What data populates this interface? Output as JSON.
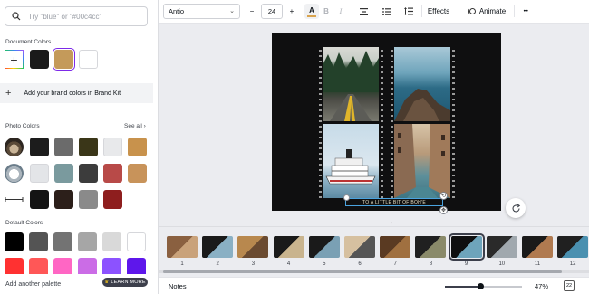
{
  "colors": {
    "accent": "#7d2ae8",
    "selection_blue": "#4aa3df",
    "text_color_bar": "#d9a44f"
  },
  "search": {
    "placeholder": "Try \"blue\" or \"#00c4cc\"",
    "icon": "search-icon"
  },
  "document_colors": {
    "title": "Document Colors",
    "swatches": [
      "#1a1a1a",
      "#c49a5a",
      "#ffffff"
    ],
    "selected_index": 1
  },
  "brand_kit": {
    "label": "Add your brand colors in Brand Kit"
  },
  "photo_colors": {
    "title": "Photo Colors",
    "see_all": "See all",
    "rows": [
      [
        "#1c1c1c",
        "#6b6b6b",
        "#3a3618",
        "#e8e9eb",
        "#c8924c"
      ],
      [
        "#e3e5e8",
        "#7a9a9e",
        "#3c3c3c",
        "#b84a48",
        "#c8935a"
      ],
      [
        "#141414",
        "#2c1f1a",
        "#8a8a8a",
        "#8e1e1e"
      ]
    ]
  },
  "default_colors": {
    "title": "Default Colors",
    "rows": [
      [
        "#000000",
        "#545454",
        "#737373",
        "#a6a6a6",
        "#d9d9d9",
        "#ffffff"
      ],
      [
        "#ff3131",
        "#ff5757",
        "#ff66c4",
        "#cb6ce6",
        "#8c52ff",
        "#5e17eb"
      ]
    ]
  },
  "panel_footer": {
    "add_palette": "Add another palette",
    "learn_more": "LEARN MORE"
  },
  "toolbar": {
    "font": "Antio",
    "minus": "−",
    "size": "24",
    "plus": "+",
    "text_color_label": "A",
    "bold": "B",
    "italic": "I",
    "effects": "Effects",
    "animate": "Animate",
    "more": "•••"
  },
  "canvas": {
    "caption": "TO A LITTLE BIT OF BOH'E"
  },
  "pages": {
    "labels": [
      "1",
      "2",
      "3",
      "4",
      "5",
      "6",
      "7",
      "8",
      "9",
      "10",
      "11",
      "12"
    ],
    "active_index": 8
  },
  "footer": {
    "notes": "Notes",
    "zoom": "47%",
    "zoom_fraction": 0.47,
    "page_count_badge": "22"
  }
}
